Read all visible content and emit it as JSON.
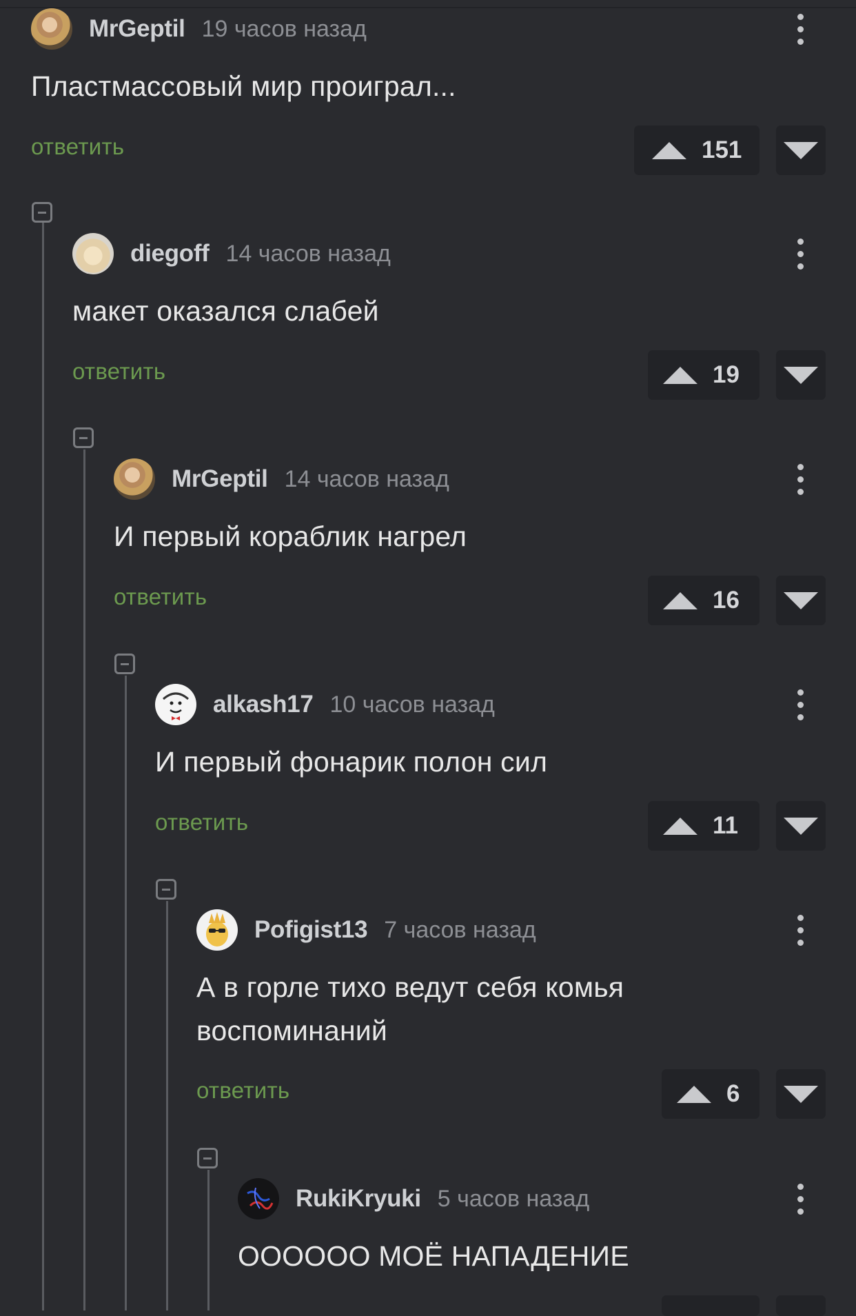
{
  "comments": [
    {
      "author": "MrGeptil",
      "time": "19 часов назад",
      "text": "Пластмассовый мир проиграл...",
      "reply": "ответить",
      "votes": "151",
      "avatar": "avatar-mrgeptil"
    },
    {
      "author": "diegoff",
      "time": "14 часов назад",
      "text": "макет оказался слабей",
      "reply": "ответить",
      "votes": "19",
      "avatar": "avatar-diegoff"
    },
    {
      "author": "MrGeptil",
      "time": "14 часов назад",
      "text": "И первый кораблик нагрел",
      "reply": "ответить",
      "votes": "16",
      "avatar": "avatar-mrgeptil"
    },
    {
      "author": "alkash17",
      "time": "10 часов назад",
      "text": "И первый фонарик полон сил",
      "reply": "ответить",
      "votes": "11",
      "avatar": "avatar-alkash17"
    },
    {
      "author": "Pofigist13",
      "time": "7 часов назад",
      "text_line1": "А в горле тихо ведут себя комья",
      "text_line2": "воспоминаний",
      "reply": "ответить",
      "votes": "6",
      "avatar": "avatar-pofigist13"
    },
    {
      "author": "RukiKryuki",
      "time": "5 часов назад",
      "text": "ОООООО МОЁ НАПАДЕНИЕ",
      "avatar": "avatar-rukikryuki"
    }
  ],
  "colors": {
    "background": "#2a2b2f",
    "reply_link": "#6c9a4f",
    "vote_box": "#222327"
  }
}
